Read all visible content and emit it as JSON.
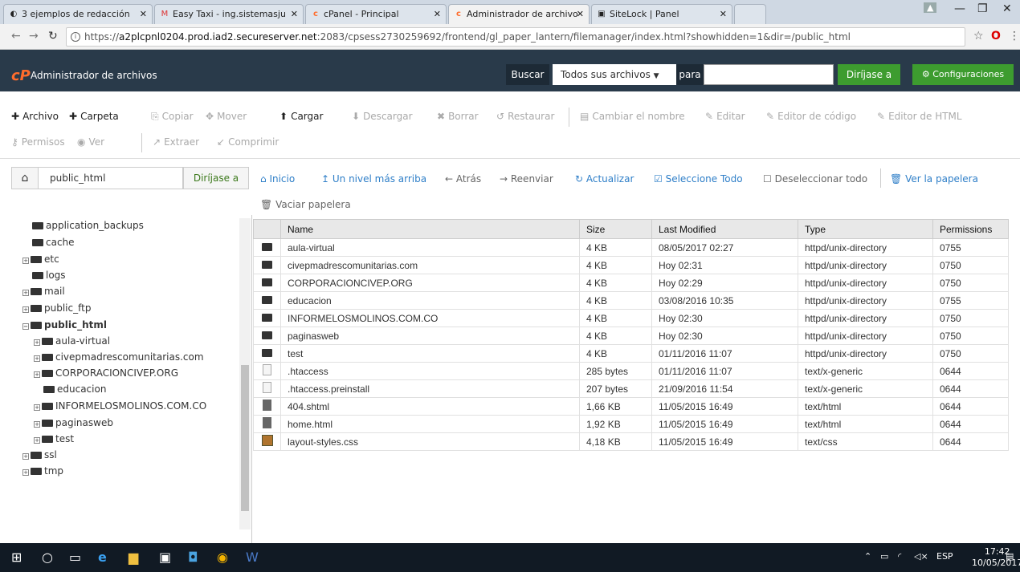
{
  "browser": {
    "tabs": [
      {
        "label": "3 ejemplos de redacción",
        "icon": "page-icon"
      },
      {
        "label": "Easy Taxi - ing.sistemasju",
        "icon": "gmail-icon"
      },
      {
        "label": "cPanel - Principal",
        "icon": "cpanel-icon"
      },
      {
        "label": "Administrador de archivo",
        "icon": "cpanel-icon"
      },
      {
        "label": "SiteLock | Panel",
        "icon": "sitelock-icon"
      }
    ],
    "url_prefix": "https://",
    "url_host": "a2plcpnl0204.prod.iad2.secureserver.net",
    "url_rest": ":2083/cpsess2730259692/frontend/gl_paper_lantern/filemanager/index.html?showhidden=1&dir=/public_html"
  },
  "header": {
    "title": "Administrador de archivos",
    "search_label": "Buscar",
    "search_scope": "Todos sus archivos",
    "para_label": "para",
    "go_label": "Diríjase a",
    "settings_label": "Configuraciones"
  },
  "toolbar": {
    "row1": [
      {
        "label": "Archivo",
        "glyph": "+",
        "enabled": true
      },
      {
        "label": "Carpeta",
        "glyph": "+",
        "enabled": true
      },
      {
        "label": "Copiar",
        "glyph": "⎘",
        "enabled": false
      },
      {
        "label": "Mover",
        "glyph": "✥",
        "enabled": false
      },
      {
        "label": "Cargar",
        "glyph": "⬆",
        "enabled": true
      },
      {
        "label": "Descargar",
        "glyph": "⬇",
        "enabled": false
      },
      {
        "label": "Borrar",
        "glyph": "✖",
        "enabled": false
      },
      {
        "label": "Restaurar",
        "glyph": "↺",
        "enabled": false
      },
      {
        "label": "Cambiar el nombre",
        "glyph": "▤",
        "enabled": false
      },
      {
        "label": "Editar",
        "glyph": "✎",
        "enabled": false
      },
      {
        "label": "Editor de código",
        "glyph": "✎",
        "enabled": false
      },
      {
        "label": "Editor de HTML",
        "glyph": "✎",
        "enabled": false
      }
    ],
    "row2": [
      {
        "label": "Permisos",
        "glyph": "⚷",
        "enabled": false
      },
      {
        "label": "Ver",
        "glyph": "◉",
        "enabled": false
      },
      {
        "label": "Extraer",
        "glyph": "↗",
        "enabled": false
      },
      {
        "label": "Comprimir",
        "glyph": "↙",
        "enabled": false
      }
    ]
  },
  "pathbar": {
    "path": "public_html",
    "go_label": "Diríjase a"
  },
  "navlinks": {
    "inicio": "Inicio",
    "up": "Un nivel más arriba",
    "back": "Atrás",
    "forward": "Reenviar",
    "refresh": "Actualizar",
    "select_all": "Seleccione Todo",
    "deselect_all": "Deseleccionar todo",
    "trash": "Ver la papelera",
    "empty_trash": "Vaciar papelera"
  },
  "tree": [
    {
      "label": "application_backups",
      "level": 1,
      "expander": ""
    },
    {
      "label": "cache",
      "level": 1,
      "expander": ""
    },
    {
      "label": "etc",
      "level": 1,
      "expander": "+"
    },
    {
      "label": "logs",
      "level": 1,
      "expander": ""
    },
    {
      "label": "mail",
      "level": 1,
      "expander": "+"
    },
    {
      "label": "public_ftp",
      "level": 1,
      "expander": "+"
    },
    {
      "label": "public_html",
      "level": 1,
      "expander": "-",
      "current": true
    },
    {
      "label": "aula-virtual",
      "level": 2,
      "expander": "+"
    },
    {
      "label": "civepmadrescomunitarias.com",
      "level": 2,
      "expander": "+"
    },
    {
      "label": "CORPORACIONCIVEP.ORG",
      "level": 2,
      "expander": "+"
    },
    {
      "label": "educacion",
      "level": 2,
      "expander": ""
    },
    {
      "label": "INFORMELOSMOLINOS.COM.CO",
      "level": 2,
      "expander": "+"
    },
    {
      "label": "paginasweb",
      "level": 2,
      "expander": "+"
    },
    {
      "label": "test",
      "level": 2,
      "expander": "+"
    },
    {
      "label": "ssl",
      "level": 1,
      "expander": "+"
    },
    {
      "label": "tmp",
      "level": 1,
      "expander": "+"
    }
  ],
  "table": {
    "headers": [
      "Name",
      "Size",
      "Last Modified",
      "Type",
      "Permissions"
    ],
    "rows": [
      {
        "icon": "folder",
        "name": "aula-virtual",
        "size": "4 KB",
        "modified": "08/05/2017 02:27",
        "type": "httpd/unix-directory",
        "perm": "0755"
      },
      {
        "icon": "folder",
        "name": "civepmadrescomunitarias.com",
        "size": "4 KB",
        "modified": "Hoy 02:31",
        "type": "httpd/unix-directory",
        "perm": "0750"
      },
      {
        "icon": "folder",
        "name": "CORPORACIONCIVEP.ORG",
        "size": "4 KB",
        "modified": "Hoy 02:29",
        "type": "httpd/unix-directory",
        "perm": "0750"
      },
      {
        "icon": "folder",
        "name": "educacion",
        "size": "4 KB",
        "modified": "03/08/2016 10:35",
        "type": "httpd/unix-directory",
        "perm": "0755"
      },
      {
        "icon": "folder",
        "name": "INFORMELOSMOLINOS.COM.CO",
        "size": "4 KB",
        "modified": "Hoy 02:30",
        "type": "httpd/unix-directory",
        "perm": "0750"
      },
      {
        "icon": "folder",
        "name": "paginasweb",
        "size": "4 KB",
        "modified": "Hoy 02:30",
        "type": "httpd/unix-directory",
        "perm": "0750"
      },
      {
        "icon": "folder",
        "name": "test",
        "size": "4 KB",
        "modified": "01/11/2016 11:07",
        "type": "httpd/unix-directory",
        "perm": "0750"
      },
      {
        "icon": "doc",
        "name": ".htaccess",
        "size": "285 bytes",
        "modified": "01/11/2016 11:07",
        "type": "text/x-generic",
        "perm": "0644"
      },
      {
        "icon": "doc",
        "name": ".htaccess.preinstall",
        "size": "207 bytes",
        "modified": "21/09/2016 11:54",
        "type": "text/x-generic",
        "perm": "0644"
      },
      {
        "icon": "html",
        "name": "404.shtml",
        "size": "1,66 KB",
        "modified": "11/05/2015 16:49",
        "type": "text/html",
        "perm": "0644"
      },
      {
        "icon": "html",
        "name": "home.html",
        "size": "1,92 KB",
        "modified": "11/05/2015 16:49",
        "type": "text/html",
        "perm": "0644"
      },
      {
        "icon": "css",
        "name": "layout-styles.css",
        "size": "4,18 KB",
        "modified": "11/05/2015 16:49",
        "type": "text/css",
        "perm": "0644"
      }
    ]
  },
  "taskbar": {
    "lang": "ESP",
    "time": "17:42",
    "date": "10/05/2017"
  }
}
